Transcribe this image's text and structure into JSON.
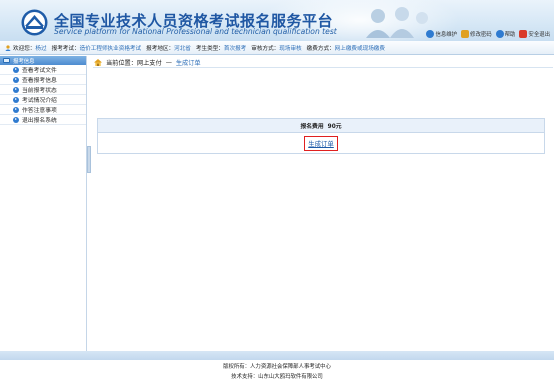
{
  "header": {
    "title_cn": "全国专业技术人员资格考试报名服务平台",
    "title_en": "Service platform for National Professional and technician qualification test",
    "links": [
      {
        "label": "信息维护",
        "icon": "info-maintain-icon",
        "color": "#2f7bd0"
      },
      {
        "label": "修改密码",
        "icon": "change-password-icon",
        "color": "#e0a020"
      },
      {
        "label": "帮助",
        "icon": "help-icon",
        "color": "#2f7bd0"
      },
      {
        "label": "安全退出",
        "icon": "logout-icon",
        "color": "#d93a2a"
      }
    ]
  },
  "info_bar": {
    "welcome_label": "欢迎您：",
    "user": "杨过",
    "exam_label": "报考考试：",
    "exam": "造价工程师执业资格考试",
    "region_label": "报考地区：",
    "region": "河北省",
    "candidate_type_label": "考生类型：",
    "candidate_type": "首次报考",
    "review_label": "审核方式：",
    "review": "现场审核",
    "payment_label": "缴费方式：",
    "payment": "网上缴费或现场缴费"
  },
  "sidebar": {
    "header": "报考信息",
    "items": [
      {
        "label": "查看考试文件"
      },
      {
        "label": "查看报考信息"
      },
      {
        "label": "当前报考状态"
      },
      {
        "label": "考试情况介绍"
      },
      {
        "label": "作答注意事项"
      },
      {
        "label": "退出报名系统"
      }
    ]
  },
  "breadcrumb": {
    "current_label": "当前位置：",
    "section": "网上支付",
    "separator": "—",
    "page": "生成订单"
  },
  "fee": {
    "label": "报名费用",
    "amount": "90元"
  },
  "order_button": "生成订单",
  "footer": {
    "line1": "版权所有：人力资源社会保障部人事考试中心",
    "line2": "技术支持：山东山大鸥玛软件有限公司"
  },
  "colors": {
    "accent": "#2f7bd0",
    "title": "#1f57a3",
    "link": "#2e6fb8",
    "highlight_border": "#e02020"
  }
}
